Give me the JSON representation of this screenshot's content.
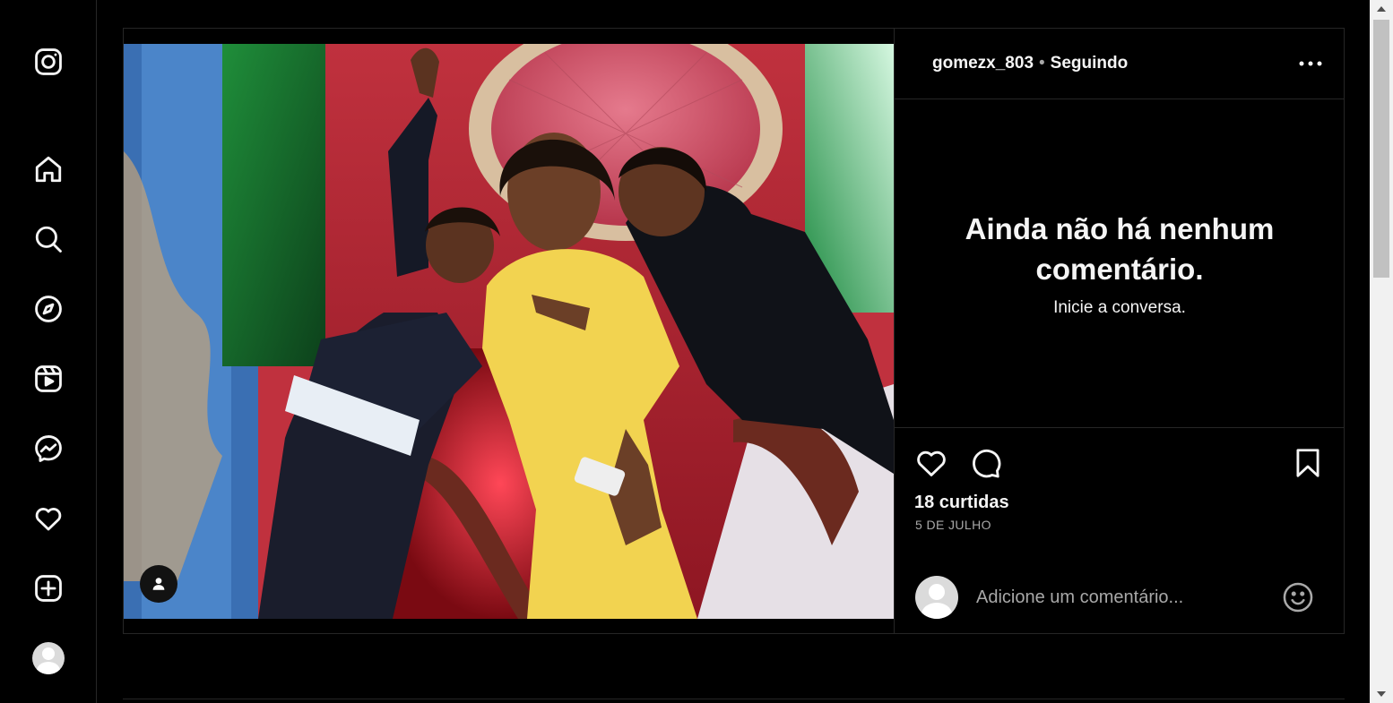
{
  "nav": {
    "items": [
      {
        "name": "instagram-logo-icon"
      },
      {
        "name": "home-icon"
      },
      {
        "name": "search-icon"
      },
      {
        "name": "explore-icon"
      },
      {
        "name": "reels-icon"
      },
      {
        "name": "messenger-icon"
      },
      {
        "name": "heart-icon"
      },
      {
        "name": "create-icon"
      },
      {
        "name": "profile-avatar"
      }
    ]
  },
  "post": {
    "username": "gomezx_803",
    "separator": "•",
    "follow_status": "Seguindo",
    "more_icon": "more-horizontal-icon",
    "empty_comments": {
      "title": "Ainda não há nenhum comentário.",
      "subtitle": "Inicie a conversa."
    },
    "likes": "18 curtidas",
    "date": "5 DE JULHO",
    "comment_placeholder": "Adicione um comentário...",
    "icons": {
      "like": "heart-icon",
      "comment": "comment-bubble-icon",
      "save": "bookmark-icon",
      "emoji": "emoji-icon",
      "tag": "user-tag-icon"
    }
  },
  "colors": {
    "background": "#000000",
    "border": "#262626",
    "text": "#f5f5f5",
    "secondary_text": "#a8a8a8"
  }
}
